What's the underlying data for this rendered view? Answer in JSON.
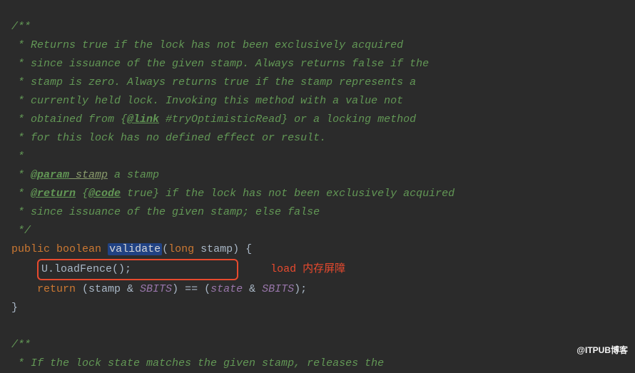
{
  "comment1": {
    "open": "/**",
    "l1": " * Returns true if the lock has not been exclusively acquired",
    "l2": " * since issuance of the given stamp. Always returns false if the",
    "l3": " * stamp is zero. Always returns true if the stamp represents a",
    "l4": " * currently held lock. Invoking this method with a value not",
    "l5a": " * obtained from {",
    "l5tag": "@link",
    "l5b": " #tryOptimisticRead} or a locking method",
    "l6": " * for this lock has no defined effect or result.",
    "l7": " *",
    "l8a": " * ",
    "l8tag": "@param",
    "l8pname": " stamp",
    "l8b": " a stamp",
    "l9a": " * ",
    "l9tag": "@return",
    "l9b": " {",
    "l9tag2": "@code",
    "l9c": " true} if the lock has not been exclusively acquired",
    "l10": " * since issuance of the given stamp; else false",
    "close": " */"
  },
  "code": {
    "kw_public": "public",
    "kw_boolean": "boolean",
    "method": "validate",
    "params_open": "(",
    "type_long": "long",
    "param_name": " stamp)",
    "brace_open": " {",
    "call_U": "U",
    "call_load": ".loadFence();",
    "annotation": "load 内存屏障",
    "kw_return": "return",
    "ret_a": " (stamp & ",
    "sbits": "SBITS",
    "ret_b": ") == (",
    "state": "state",
    "ret_c": " & ",
    "ret_d": ");",
    "brace_close": "}"
  },
  "comment2": {
    "open": "/**",
    "l1": " * If the lock state matches the given stamp, releases the"
  },
  "watermark": "@ITPUB博客"
}
